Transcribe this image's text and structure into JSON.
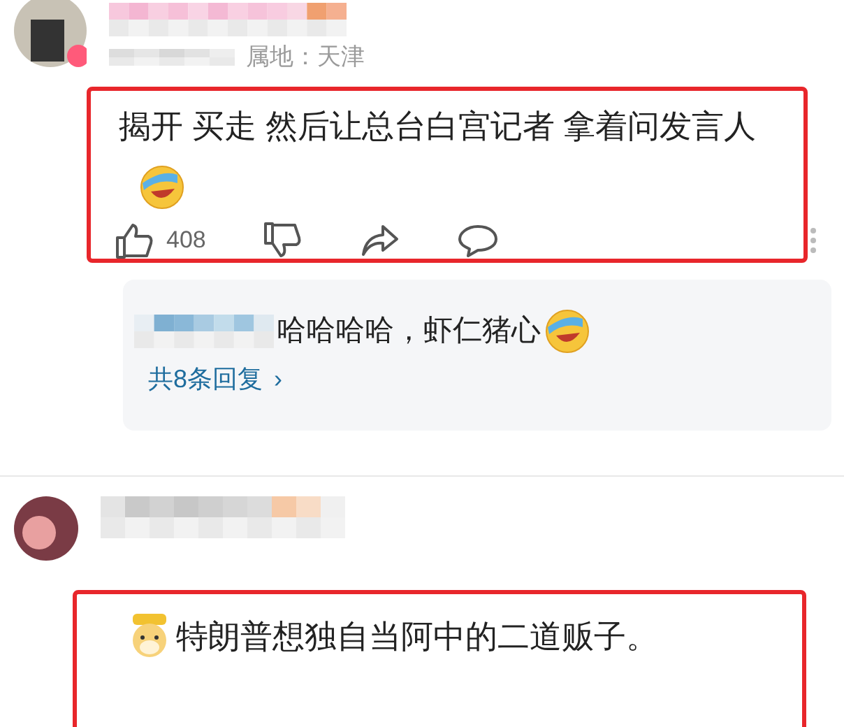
{
  "comments": [
    {
      "location": "属地：天津",
      "text": "揭开 买走 然后让总台白宫记者 拿着问发言人",
      "likes": "408",
      "reply_preview": {
        "text": "哈哈哈哈，虾仁猪心",
        "more": "共8条回复",
        "chevron": "›"
      }
    },
    {
      "text": "特朗普想独自当阿中的二道贩子。"
    }
  ]
}
